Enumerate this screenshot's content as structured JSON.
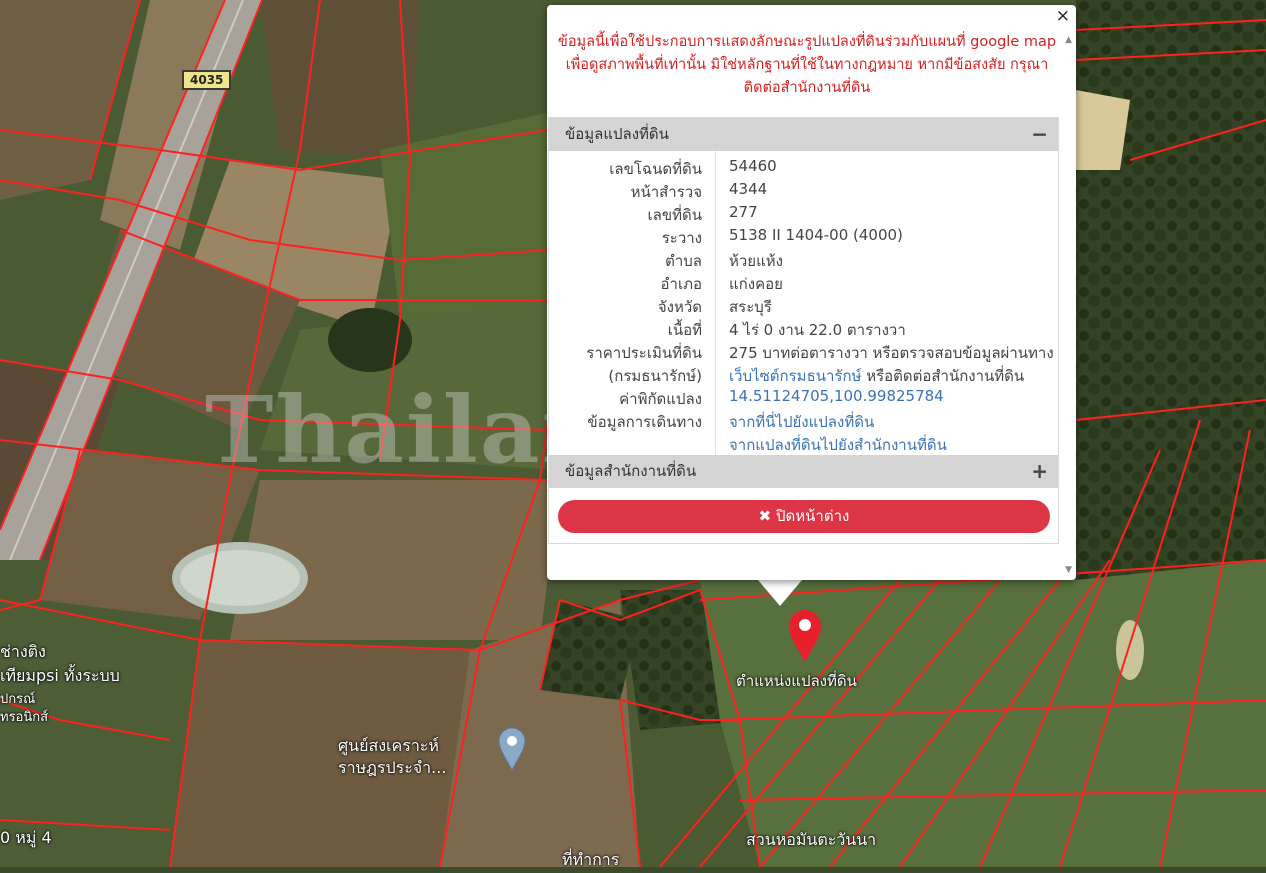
{
  "map": {
    "route_shield": "4035",
    "place_labels": [
      "ช่างติง",
      "เทียมpsi ทั้งระบบ",
      "ุปกรณ์",
      "ทรอนิกส์",
      "ศูนย์สงเคราะห์",
      "ราษฎรประจำ...",
      "0 หมู่ 4",
      "สวนหอมันตะวันนา",
      "ที่ทำการ"
    ],
    "marker_label": "ตำแหน่งแปลงที่ดิน",
    "watermark": "Thailandza.com",
    "parcel_line_color": "#ff2020",
    "marker_color": "#e8202c"
  },
  "popup": {
    "close_icon": "×",
    "disclaimer": [
      "ข้อมูลนี้เพื่อใช้ประกอบการแสดงลักษณะรูปแปลงที่ดินร่วมกับแผนที่ google map",
      "เพื่อดูสภาพพื้นที่เท่านั้น มิใช่หลักฐานที่ใช้ในทางกฎหมาย หากมีข้อสงสัย กรุณา",
      "ติดต่อสำนักงานที่ดิน"
    ],
    "parcel_section": {
      "title": "ข้อมูลแปลงที่ดิน",
      "toggle": "−",
      "rows": [
        {
          "key": "เลขโฉนดที่ดิน",
          "value": "54460"
        },
        {
          "key": "หน้าสำรวจ",
          "value": "4344"
        },
        {
          "key": "เลขที่ดิน",
          "value": "277"
        },
        {
          "key": "ระวาง",
          "value": "5138 II 1404-00 (4000)"
        },
        {
          "key": "ตำบล",
          "value": "ห้วยแห้ง"
        },
        {
          "key": "อำเภอ",
          "value": "แก่งคอย"
        },
        {
          "key": "จังหวัด",
          "value": "สระบุรี"
        },
        {
          "key": "เนื้อที่",
          "value": "4 ไร่ 0 งาน 22.0 ตารางวา"
        },
        {
          "key": "ราคาประเมินที่ดิน",
          "value": "275 บาทต่อตารางวา หรือตรวจสอบข้อมูลผ่านทาง"
        },
        {
          "key": "(กรมธนารักษ์)",
          "link": "เว็บไซต์กรมธนารักษ์",
          "value": " หรือติดต่อสำนักงานที่ดิน"
        },
        {
          "key": "ค่าพิกัดแปลง",
          "link": "14.51124705,100.99825784"
        },
        {
          "key": "ข้อมูลการเดินทาง",
          "link": "จากที่นี่ไปยังแปลงที่ดิน"
        },
        {
          "key": "",
          "link": "จากแปลงที่ดินไปยังสำนักงานที่ดิน"
        }
      ]
    },
    "office_section": {
      "title": "ข้อมูลสำนักงานที่ดิน",
      "toggle": "+"
    },
    "close_button": {
      "icon": "✖",
      "label": "ปิดหน้าต่าง",
      "color": "#dc3545"
    }
  }
}
